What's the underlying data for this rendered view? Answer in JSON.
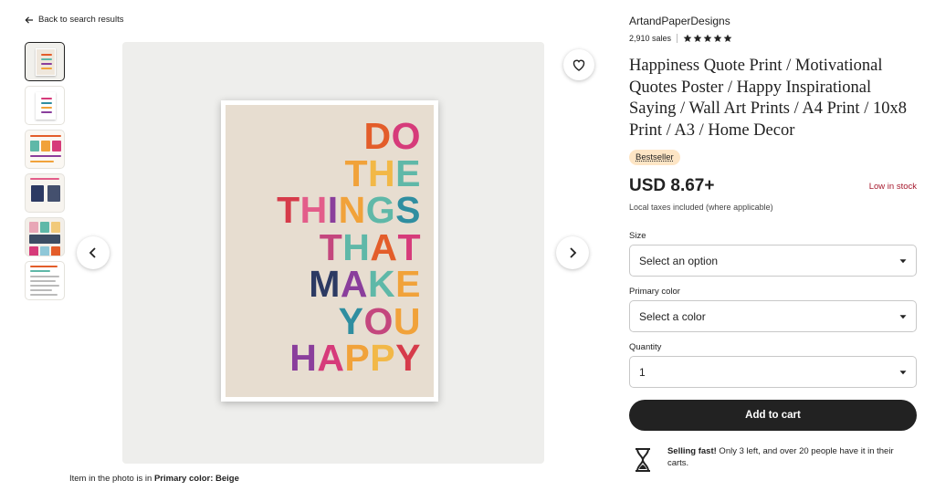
{
  "nav": {
    "back_label": "Back to search results"
  },
  "gallery": {
    "caption_prefix": "Item in the photo is in ",
    "caption_value": "Primary color: Beige",
    "poster_lines": [
      {
        "text": "DO",
        "colors": [
          "#e35d2a",
          "#d63b7a"
        ]
      },
      {
        "text": "THE",
        "colors": [
          "#f1a23a",
          "#f2b847",
          "#5fb8a8"
        ]
      },
      {
        "text": "THINGS",
        "colors": [
          "#d63b4a",
          "#e35d8a",
          "#8a3e9c",
          "#f1a23a",
          "#5fb8a8",
          "#2f8ea0"
        ]
      },
      {
        "text": "THAT",
        "colors": [
          "#c4477e",
          "#5fb8a8",
          "#e35d2a",
          "#d63b7a"
        ]
      },
      {
        "text": "MAKE",
        "colors": [
          "#2c3a63",
          "#8a3e9c",
          "#5fb8a8",
          "#f1a23a"
        ]
      },
      {
        "text": "YOU",
        "colors": [
          "#2f8ea0",
          "#c4477e",
          "#f1a23a"
        ]
      },
      {
        "text": "HAPPY",
        "colors": [
          "#8a3e9c",
          "#d63b7a",
          "#f1a23a",
          "#f2b847",
          "#d63b4a"
        ]
      }
    ]
  },
  "listing": {
    "shop_name": "ArtandPaperDesigns",
    "sales": "2,910 sales",
    "rating_stars": 5,
    "title": "Happiness Quote Print / Motivational Quotes Poster / Happy Inspirational Saying / Wall Art Prints / A4 Print / 10x8 Print / A3 / Home Decor",
    "badge": "Bestseller",
    "price": "USD 8.67+",
    "stock": "Low in stock",
    "tax_note": "Local taxes included (where applicable)"
  },
  "options": {
    "size_label": "Size",
    "size_value": "Select an option",
    "color_label": "Primary color",
    "color_value": "Select a color",
    "quantity_label": "Quantity",
    "quantity_value": "1"
  },
  "cart": {
    "button_label": "Add to cart"
  },
  "selling_fast": {
    "strong": "Selling fast!",
    "text": " Only 3 left, and over 20 people have it in their carts."
  },
  "colors": {
    "accent": "#222222",
    "stock_red": "#a61a2e",
    "badge_bg": "#fde5c5"
  }
}
